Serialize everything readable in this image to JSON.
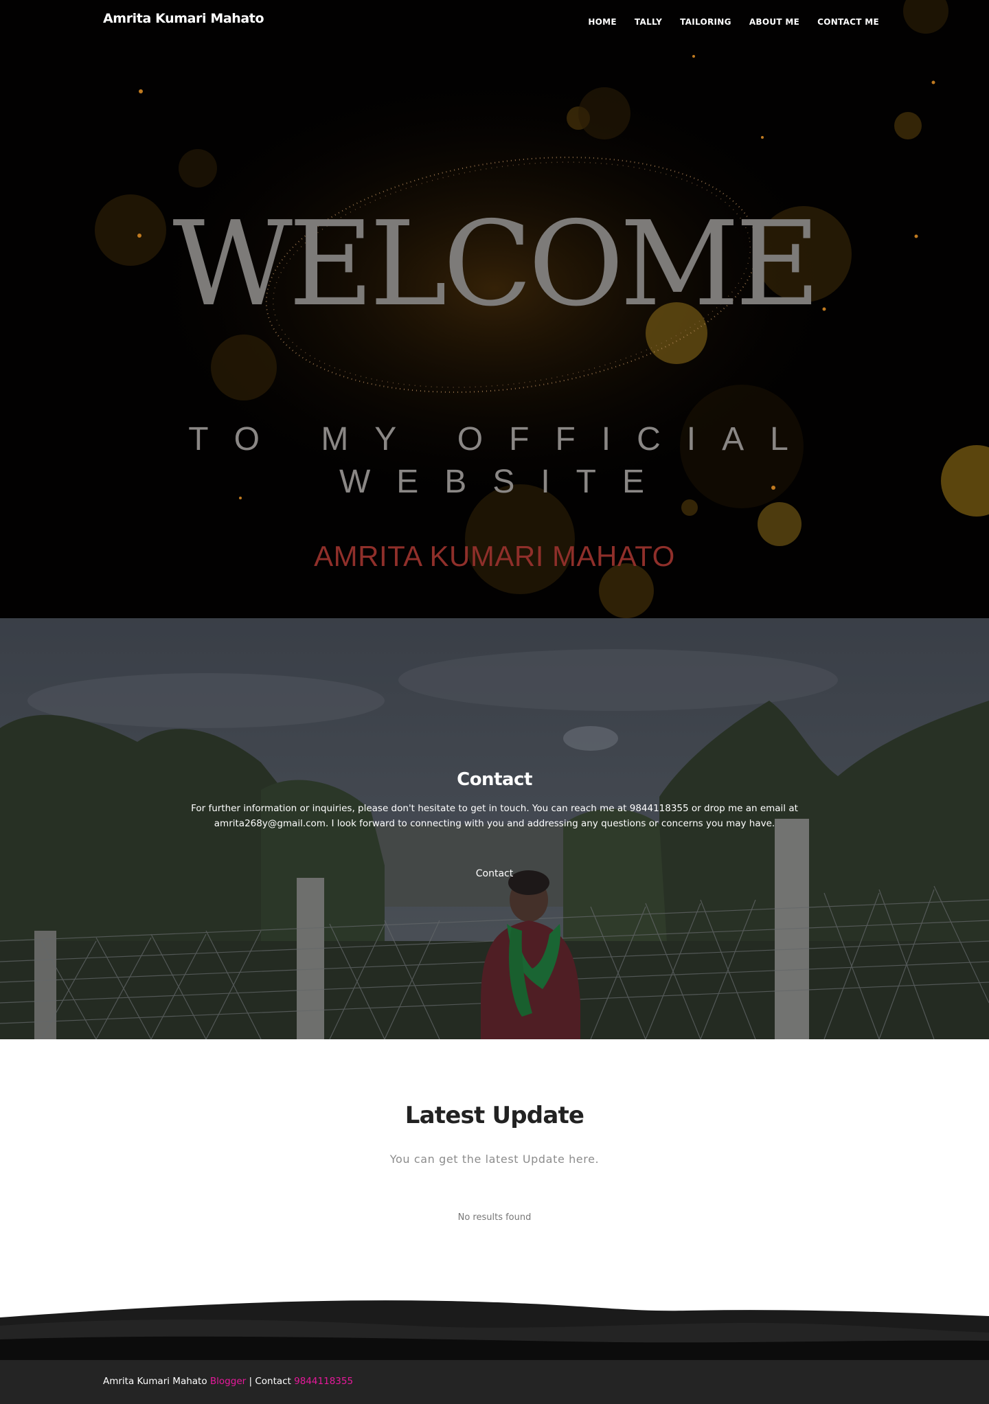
{
  "site": {
    "brand": "Amrita Kumari Mahato"
  },
  "nav": {
    "items": [
      "HOME",
      "TALLY",
      "TAILORING",
      "ABOUT ME",
      "CONTACT ME"
    ]
  },
  "hero": {
    "welcome": "WELCOME",
    "line1": "TO MY OFFICIAL",
    "line2": "WEBSITE",
    "name": "AMRITA KUMARI MAHATO"
  },
  "contact": {
    "title": "Contact",
    "text": "For further information or inquiries, please don't hesitate to get in touch. You can reach me at 9844118355 or drop me an email at amrita268y@gmail.com. I look forward to connecting with you and addressing any questions or concerns you may have.",
    "link": "Contact"
  },
  "latest": {
    "title": "Latest Update",
    "subtitle": "You can get the latest Update here.",
    "empty": "No results found"
  },
  "footer": {
    "name": "Amrita Kumari Mahato",
    "role": "Blogger",
    "separator": "| Contact",
    "phone": "9844118355"
  },
  "colors": {
    "accent": "#e6199b",
    "hero_bg": "#020101",
    "footer_bg": "#242424",
    "hero_name": "#8f2f2a"
  }
}
